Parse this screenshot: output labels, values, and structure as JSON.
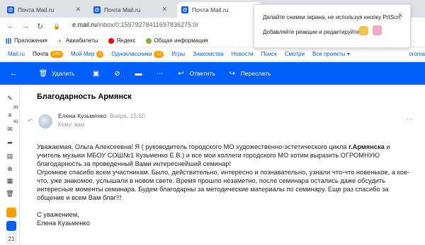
{
  "browser": {
    "tabs": [
      {
        "label": "Почта Mail.ru",
        "active": false
      },
      {
        "label": "Почта Mail.ru",
        "active": false
      },
      {
        "label": "Почта Mail.ru",
        "active": true
      }
    ],
    "url_host": "e.mail.ru",
    "url_path": "/inbox/0:15979278411697836275:0/",
    "bookmarks": [
      "Приложения",
      "Авиабилеты",
      "Яндекс",
      "Общая информация"
    ]
  },
  "popup": {
    "line1": "Делайте снимки экрана, не используя кнопку PrtScn.",
    "line2": "Добавляйте реакции и редактируйте"
  },
  "portal": {
    "items": [
      {
        "label": "Mail.ru"
      },
      {
        "label": "Почта",
        "badge": "141"
      },
      {
        "label": "Мой Мир",
        "badge": "1"
      },
      {
        "label": "Одноклассники",
        "badge": "12"
      },
      {
        "label": "Игры"
      },
      {
        "label": "Знакомства"
      },
      {
        "label": "Новости"
      },
      {
        "label": "Поиск"
      },
      {
        "label": "Смотри"
      },
      {
        "label": "Все проекты ▾"
      }
    ],
    "right": "oroma"
  },
  "toolbar": {
    "delete": "Удалить",
    "reply": "Ответить",
    "forward": "Переслать"
  },
  "rail": {
    "badge1": "99",
    "badge2": "42"
  },
  "message": {
    "subject": "Благодарность Армянск",
    "sender": "Елена Кузьменко",
    "date": "Вчера, 15:50",
    "to": "Кому: вам",
    "p1a": "Уважаемая, Ольга Алексеевна! Я ( руководитель городского МО художественно-эстетического  цикла ",
    "p1b": "г.Армянска",
    "p1c": " и учитель музыки МБОУ СОШ№1 Кузьменко Е.В.) и все мои коллеги  городского МО хотим выразить ОГРОМНУЮ благодарность за проведенный  Вами интереснейший  семинар!",
    "p2": "Огромное спасибо всем участникам. Было, действительно, интересно и познавательно, узнали что-что новенькое, а кое-что, уже знакомое, услышали в новом свете. Время прошло незаметно, после семинара остались даже обсудить интересные моменты семинара. Будем благодарны за  методические материалы по семинару. Еще раз спасибо за общение и всем Вам благ!!!",
    "sign1": "С уважением,",
    "sign2": "Елена Кузьменко"
  }
}
